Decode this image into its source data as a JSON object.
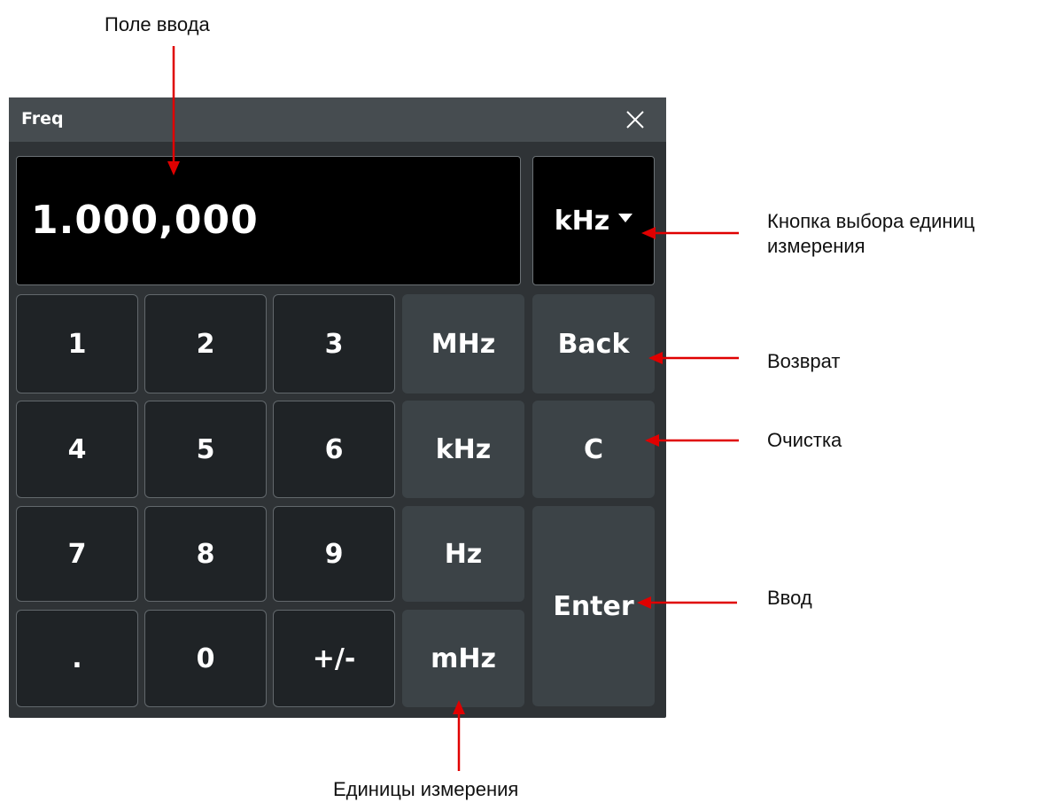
{
  "annotations": {
    "input_field": "Поле ввода",
    "unit_button": "Кнопка выбора единиц\nизмерения",
    "back": "Возврат",
    "clear": "Очистка",
    "enter": "Ввод",
    "units": "Единицы измерения"
  },
  "dialog": {
    "title": "Freq",
    "close_icon": "close-icon",
    "display_value": "1.000,000",
    "unit_select": {
      "label": "kHz",
      "icon": "caret-down-icon"
    }
  },
  "keypad": {
    "digits": {
      "k1": "1",
      "k2": "2",
      "k3": "3",
      "k4": "4",
      "k5": "5",
      "k6": "6",
      "k7": "7",
      "k8": "8",
      "k9": "9",
      "dot": ".",
      "k0": "0",
      "sign": "+/-"
    },
    "units": {
      "mhz_big": "MHz",
      "khz": "kHz",
      "hz": "Hz",
      "mhz_small": "mHz"
    },
    "functions": {
      "back": "Back",
      "clear": "C",
      "enter": "Enter"
    }
  },
  "colors": {
    "dialog_bg": "#2f3336",
    "titlebar_bg": "#464c50",
    "display_bg": "#000000",
    "digit_key_bg": "#1f2326",
    "unit_key_bg": "#3c4347",
    "arrow": "#e00000"
  }
}
